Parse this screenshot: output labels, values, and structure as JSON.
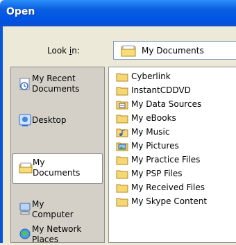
{
  "window": {
    "title": "Open"
  },
  "lookin": {
    "label": "Look in:",
    "value": "My Documents",
    "icon": "folder-icon"
  },
  "places": [
    {
      "label_line1": "My Recent",
      "label_line2": "Documents",
      "icon": "recent-documents-icon"
    },
    {
      "label_line1": "Desktop",
      "label_line2": "",
      "icon": "desktop-icon"
    },
    {
      "label_line1": "My",
      "label_line2": "Documents",
      "icon": "folder-icon",
      "selected": true
    },
    {
      "label_line1": "My",
      "label_line2": "Computer",
      "icon": "computer-icon"
    },
    {
      "label_line1": "My Network",
      "label_line2": "Places",
      "icon": "network-places-icon"
    }
  ],
  "files": [
    {
      "name": "Cyberlink",
      "icon": "folder-icon"
    },
    {
      "name": "InstantCDDVD",
      "icon": "folder-icon"
    },
    {
      "name": "My Data Sources",
      "icon": "data-sources-folder-icon"
    },
    {
      "name": "My eBooks",
      "icon": "folder-icon"
    },
    {
      "name": "My Music",
      "icon": "music-folder-icon"
    },
    {
      "name": "My Pictures",
      "icon": "pictures-folder-icon"
    },
    {
      "name": "My Practice Files",
      "icon": "folder-icon"
    },
    {
      "name": "My PSP Files",
      "icon": "folder-icon"
    },
    {
      "name": "My Received Files",
      "icon": "folder-icon"
    },
    {
      "name": "My Skype Content",
      "icon": "folder-icon"
    }
  ]
}
